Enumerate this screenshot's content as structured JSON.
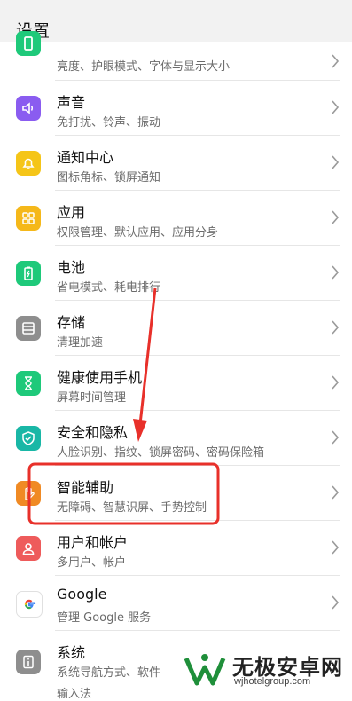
{
  "header": {
    "title": "设置"
  },
  "items": [
    {
      "label": "",
      "subtitle": "亮度、护眼模式、字体与显示大小",
      "icon": "display-icon",
      "color": "#1ec97a"
    },
    {
      "label": "声音",
      "subtitle": "免打扰、铃声、振动",
      "icon": "speaker-icon",
      "color": "#8a5cf0"
    },
    {
      "label": "通知中心",
      "subtitle": "图标角标、锁屏通知",
      "icon": "bell-icon",
      "color": "#f5c518"
    },
    {
      "label": "应用",
      "subtitle": "权限管理、默认应用、应用分身",
      "icon": "apps-grid-icon",
      "color": "#f5b81a"
    },
    {
      "label": "电池",
      "subtitle": "省电模式、耗电排行",
      "icon": "battery-icon",
      "color": "#1ec97a"
    },
    {
      "label": "存储",
      "subtitle": "清理加速",
      "icon": "storage-icon",
      "color": "#8e8e8e"
    },
    {
      "label": "健康使用手机",
      "subtitle": "屏幕时间管理",
      "icon": "hourglass-icon",
      "color": "#1ec97a"
    },
    {
      "label": "安全和隐私",
      "subtitle": "人脸识别、指纹、锁屏密码、密码保险箱",
      "icon": "shield-icon",
      "color": "#19b7a6"
    },
    {
      "label": "智能辅助",
      "subtitle": "无障碍、智慧识屏、手势控制",
      "icon": "hand-icon",
      "color": "#f08a24"
    },
    {
      "label": "用户和帐户",
      "subtitle": "多用户、帐户",
      "icon": "user-icon",
      "color": "#ee5b5b"
    },
    {
      "label": "Google",
      "subtitle": "管理 Google 服务",
      "icon": "google-icon",
      "color": "#ffffff"
    },
    {
      "label": "系统",
      "subtitle": "系统导航方式、软件",
      "subtitle2": "输入法",
      "icon": "info-icon",
      "color": "#8e8e8e"
    }
  ],
  "annotations": {
    "highlight_color": "#e8302a",
    "arrow_color": "#e8302a"
  },
  "watermark": {
    "title": "无极安卓网",
    "url": "wjhotelgroup.com"
  }
}
